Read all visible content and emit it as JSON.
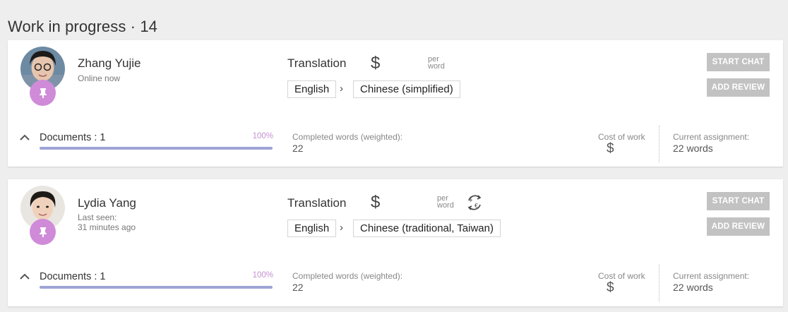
{
  "header": {
    "title": "Work in progress · 14"
  },
  "cards": [
    {
      "name": "Zhang Yujie",
      "status": "Online now",
      "service": "Translation",
      "currency_symbol": "$",
      "per_word": "per word",
      "source_language": "English",
      "target_language": "Chinese (simplified)",
      "arrow": "›",
      "start_chat_label": "START CHAT",
      "add_review_label": "ADD REVIEW",
      "documents_label": "Documents : 1",
      "progress_pct_label": "100%",
      "progress": 1.0,
      "completed_words_label": "Completed words (weighted):",
      "completed_words_value": "22",
      "cost_label": "Cost of work",
      "cost_symbol": "$",
      "assignment_label": "Current assignment:",
      "assignment_value": "22 words"
    },
    {
      "name": "Lydia Yang",
      "status_line1": "Last seen:",
      "status_line2": "31 minutes ago",
      "service": "Translation",
      "currency_symbol": "$",
      "per_word": "per word",
      "currency_icon": "currency-exchange-icon",
      "source_language": "English",
      "target_language": "Chinese (traditional, Taiwan)",
      "arrow": "›",
      "start_chat_label": "START CHAT",
      "add_review_label": "ADD REVIEW",
      "documents_label": "Documents : 1",
      "progress_pct_label": "100%",
      "progress": 1.0,
      "completed_words_label": "Completed words (weighted):",
      "completed_words_value": "22",
      "cost_label": "Cost of work",
      "cost_symbol": "$",
      "assignment_label": "Current assignment:",
      "assignment_value": "22 words"
    }
  ],
  "colors": {
    "pin_badge": "#cf8bd8",
    "progress_fill": "#9ea3d6",
    "progress_pct": "#c690d1",
    "button_bg": "#c2c2c2"
  }
}
